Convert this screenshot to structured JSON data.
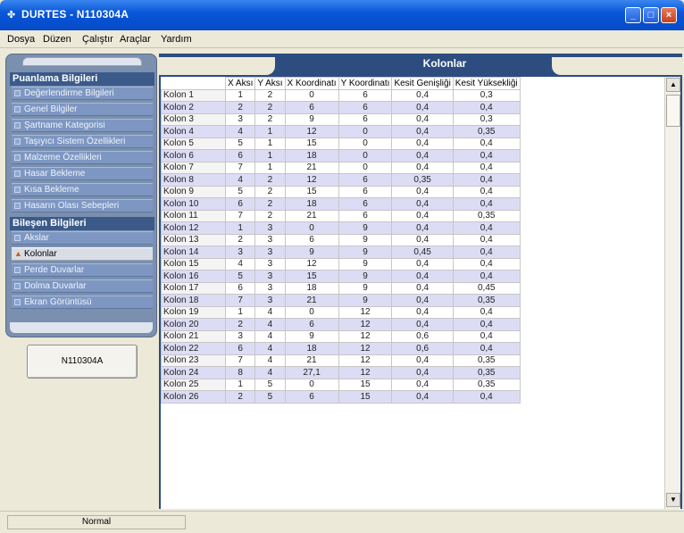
{
  "window": {
    "title": "DURTES - N110304A",
    "icon": "app-icon"
  },
  "menu": [
    "Dosya",
    "Düzen",
    "Çalıştır",
    "Araçlar",
    "Yardım"
  ],
  "sidebar": {
    "section1_title": "Puanlama Bilgileri",
    "section1_items": [
      "Değerlendirme Bilgileri",
      "Genel Bilgiler",
      "Şartname Kategorisi",
      "Taşıyıcı Sistem Özellikleri",
      "Malzeme Özellikleri",
      "Hasar Bekleme",
      "Kısa Bekleme",
      "Hasarın Olası Sebepleri"
    ],
    "section2_title": "Bileşen Bilgileri",
    "section2_items": [
      "Akslar",
      "Kolonlar",
      "Perde Duvarlar",
      "Dolma Duvarlar",
      "Ekran Görüntüsü"
    ],
    "active_item": "Kolonlar"
  },
  "project_button": "N110304A",
  "panel": {
    "title": "Kolonlar"
  },
  "table": {
    "headers": [
      "X Aksı",
      "Y Aksı",
      "X Koordinatı",
      "Y Koordinatı",
      "Kesit Genişliği",
      "Kesit Yüksekliği"
    ],
    "rows": [
      [
        "Kolon 1",
        "1",
        "2",
        "0",
        "6",
        "0,4",
        "0,3"
      ],
      [
        "Kolon 2",
        "2",
        "2",
        "6",
        "6",
        "0,4",
        "0,4"
      ],
      [
        "Kolon 3",
        "3",
        "2",
        "9",
        "6",
        "0,4",
        "0,3"
      ],
      [
        "Kolon 4",
        "4",
        "1",
        "12",
        "0",
        "0,4",
        "0,35"
      ],
      [
        "Kolon 5",
        "5",
        "1",
        "15",
        "0",
        "0,4",
        "0,4"
      ],
      [
        "Kolon 6",
        "6",
        "1",
        "18",
        "0",
        "0,4",
        "0,4"
      ],
      [
        "Kolon 7",
        "7",
        "1",
        "21",
        "0",
        "0,4",
        "0,4"
      ],
      [
        "Kolon 8",
        "4",
        "2",
        "12",
        "6",
        "0,35",
        "0,4"
      ],
      [
        "Kolon 9",
        "5",
        "2",
        "15",
        "6",
        "0,4",
        "0,4"
      ],
      [
        "Kolon 10",
        "6",
        "2",
        "18",
        "6",
        "0,4",
        "0,4"
      ],
      [
        "Kolon 11",
        "7",
        "2",
        "21",
        "6",
        "0,4",
        "0,35"
      ],
      [
        "Kolon 12",
        "1",
        "3",
        "0",
        "9",
        "0,4",
        "0,4"
      ],
      [
        "Kolon 13",
        "2",
        "3",
        "6",
        "9",
        "0,4",
        "0,4"
      ],
      [
        "Kolon 14",
        "3",
        "3",
        "9",
        "9",
        "0,45",
        "0,4"
      ],
      [
        "Kolon 15",
        "4",
        "3",
        "12",
        "9",
        "0,4",
        "0,4"
      ],
      [
        "Kolon 16",
        "5",
        "3",
        "15",
        "9",
        "0,4",
        "0,4"
      ],
      [
        "Kolon 17",
        "6",
        "3",
        "18",
        "9",
        "0,4",
        "0,45"
      ],
      [
        "Kolon 18",
        "7",
        "3",
        "21",
        "9",
        "0,4",
        "0,35"
      ],
      [
        "Kolon 19",
        "1",
        "4",
        "0",
        "12",
        "0,4",
        "0,4"
      ],
      [
        "Kolon 20",
        "2",
        "4",
        "6",
        "12",
        "0,4",
        "0,4"
      ],
      [
        "Kolon 21",
        "3",
        "4",
        "9",
        "12",
        "0,6",
        "0,4"
      ],
      [
        "Kolon 22",
        "6",
        "4",
        "18",
        "12",
        "0,6",
        "0,4"
      ],
      [
        "Kolon 23",
        "7",
        "4",
        "21",
        "12",
        "0,4",
        "0,35"
      ],
      [
        "Kolon 24",
        "8",
        "4",
        "27,1",
        "12",
        "0,4",
        "0,35"
      ],
      [
        "Kolon 25",
        "1",
        "5",
        "0",
        "15",
        "0,4",
        "0,35"
      ],
      [
        "Kolon 26",
        "2",
        "5",
        "6",
        "15",
        "0,4",
        "0,4"
      ]
    ]
  },
  "status": {
    "mode": "Normal"
  }
}
